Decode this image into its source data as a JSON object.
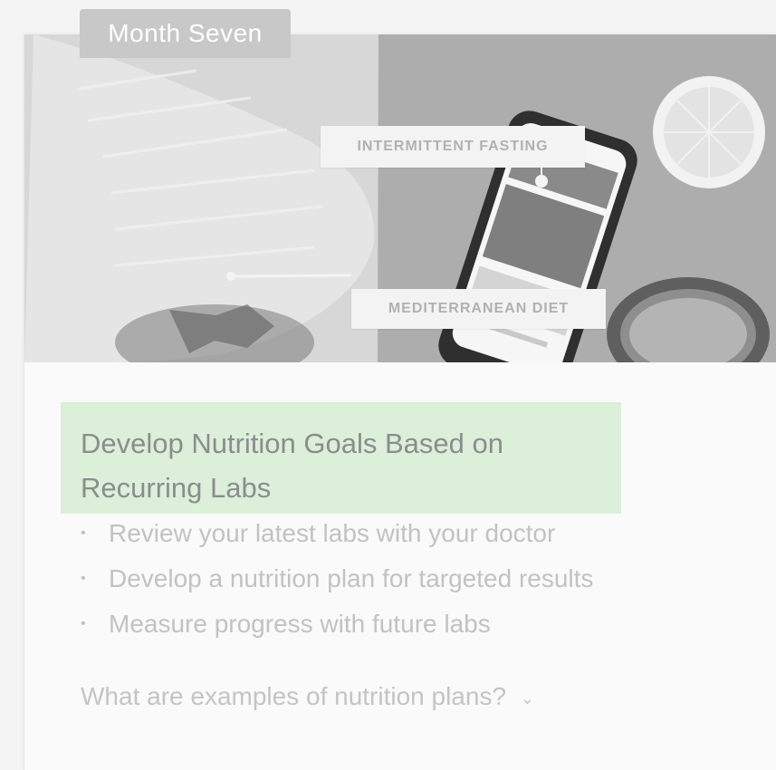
{
  "card": {
    "month_label": "Month Seven",
    "image_callouts": [
      "INTERMITTENT FASTING",
      "MEDITERRANEAN DIET"
    ],
    "heading": "Develop Nutrition Goals Based on Recurring Labs",
    "bullets": [
      "Review your latest labs with your doctor",
      "Develop a nutrition plan for targeted results",
      "Measure progress with future labs"
    ],
    "faq_question": "What are examples of nutrition plans?",
    "faq_icon": "chevron-down-icon"
  },
  "colors": {
    "highlight": "#dbefd9",
    "heading": "#8b8d8d",
    "body_text": "#c2c2c2",
    "tab_bg": "#c8c8c8"
  }
}
